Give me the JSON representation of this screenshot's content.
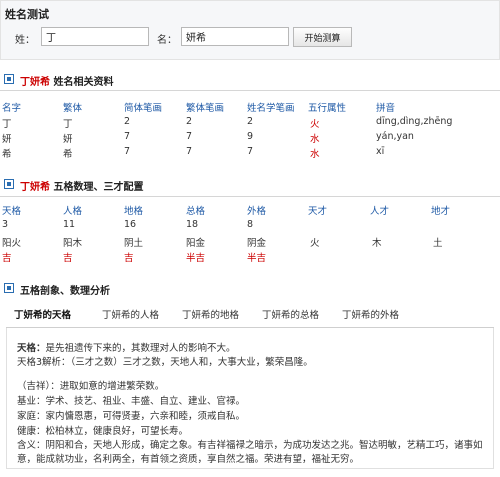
{
  "form": {
    "title": "姓名测试",
    "surname_label": "姓：",
    "surname_value": "丁",
    "given_label": "名：",
    "given_value": "妍希",
    "submit_label": "开始测算"
  },
  "sec1": {
    "name": "丁妍希",
    "title": "姓名相关资料"
  },
  "table1": {
    "headers": [
      "名字",
      "繁体",
      "简体笔画",
      "繁体笔画",
      "姓名学笔画",
      "五行属性",
      "拼音"
    ],
    "rows": [
      [
        "丁",
        "丁",
        "2",
        "2",
        "2",
        "火",
        "dīng,dìng,zhēng"
      ],
      [
        "妍",
        "妍",
        "7",
        "7",
        "9",
        "水",
        "yán,yan"
      ],
      [
        "希",
        "希",
        "7",
        "7",
        "7",
        "水",
        "xī"
      ]
    ]
  },
  "sec2": {
    "name": "丁妍希",
    "title": "五格数理、三才配置"
  },
  "table2": {
    "headers": [
      "天格",
      "人格",
      "地格",
      "总格",
      "外格",
      "天才",
      "人才",
      "地才"
    ],
    "numbers": [
      "3",
      "11",
      "16",
      "18",
      "8"
    ],
    "elements": [
      "阳火",
      "阳木",
      "阴土",
      "阳金",
      "阴金",
      "火",
      "木",
      "土"
    ],
    "luck": [
      "吉",
      "吉",
      "吉",
      "半吉",
      "半吉"
    ]
  },
  "sec3": {
    "title": "五格剖象、数理分析"
  },
  "tabs": [
    "丁妍希的天格",
    "丁妍希的人格",
    "丁妍希的地格",
    "丁妍希的总格",
    "丁妍希的外格"
  ],
  "panel": {
    "line1_label": "天格：",
    "line1_text": "是先祖遗传下来的，其数理对人的影响不大。",
    "line2": "天格3解析：（三才之数）三才之数，天地人和，大事大业，繁荣昌隆。",
    "line3": "（吉祥）：进取如意的增进繁荣数。",
    "line4": "基业：学术、技艺、祖业、丰盛、自立、建业、官禄。",
    "line5": "家庭：家内慵恩惠，可得贤妻，六亲和睦，须戒自私。",
    "line6": "健康：松柏林立，健康良好，可望长寿。",
    "line7a": "含义：阴阳和合，天地人形成，确定之象。有吉祥福禄之暗示，为成功发达之兆。智达明敏，艺精工巧，诸事如",
    "line7b": "意，能成就功业，名利两全，有首领之资质，享自然之福。荣进有望，福祉无穷。"
  }
}
